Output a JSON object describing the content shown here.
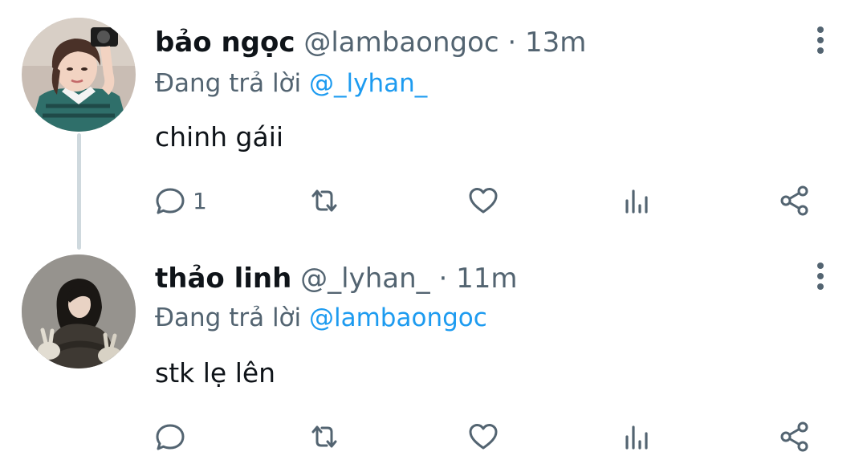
{
  "colors": {
    "text": "#0f1419",
    "secondary": "#536471",
    "accent": "#1d9bf0",
    "thread_line": "#cfd9de"
  },
  "icons": [
    "reply-icon",
    "retweet-icon",
    "like-icon",
    "views-icon",
    "share-icon",
    "more-icon"
  ],
  "tweets": [
    {
      "display_name": "bảo ngọc",
      "handle": "@lambaongoc",
      "separator": "·",
      "time": "13m",
      "reply_prefix": "Đang trả lời",
      "reply_to": "@_lyhan_",
      "text": "chinh gáii",
      "reply_count": "1"
    },
    {
      "display_name": "thảo linh",
      "handle": "@_lyhan_",
      "separator": "·",
      "time": "11m",
      "reply_prefix": "Đang trả lời",
      "reply_to": "@lambaongoc",
      "text": "stk lẹ lên",
      "reply_count": ""
    }
  ]
}
